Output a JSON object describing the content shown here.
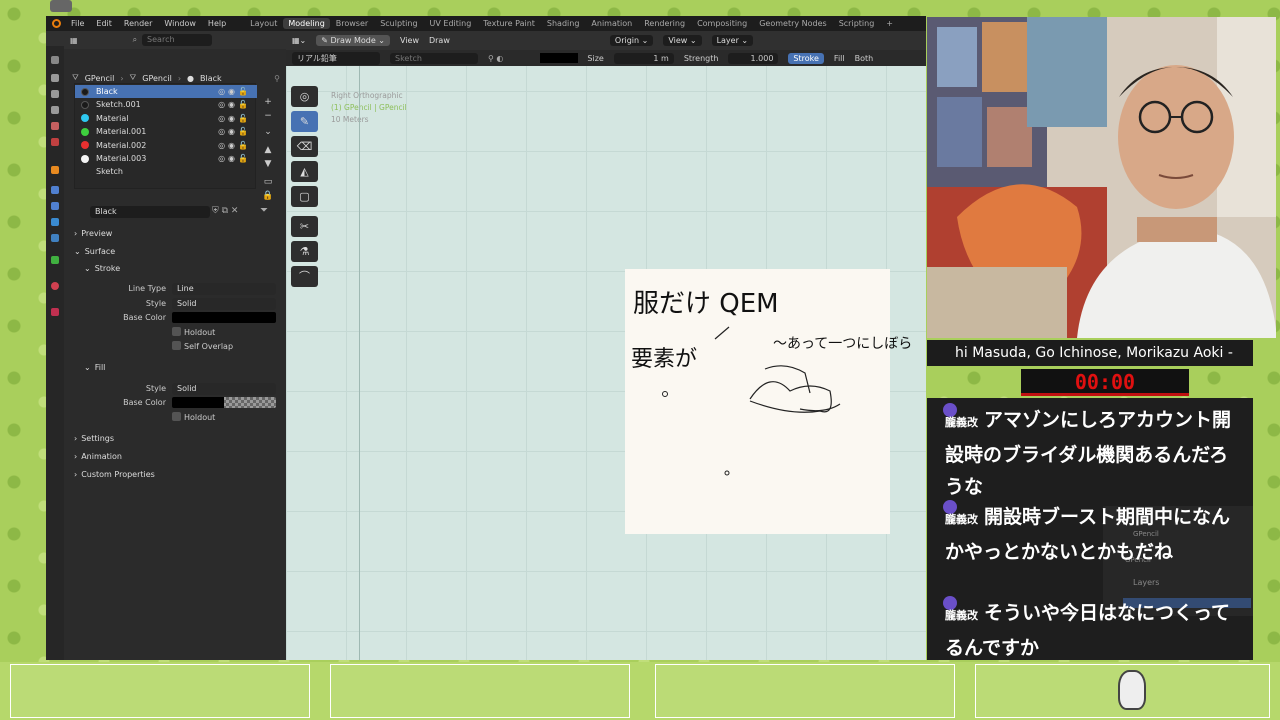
{
  "menu": {
    "items": [
      "File",
      "Edit",
      "Render",
      "Window",
      "Help"
    ]
  },
  "workspaces": [
    "Layout",
    "Modeling",
    "Browser",
    "Sculpting",
    "UV Editing",
    "Texture Paint",
    "Shading",
    "Animation",
    "Rendering",
    "Compositing",
    "Geometry Nodes",
    "Scripting",
    "+"
  ],
  "active_workspace": "Modeling",
  "properties": {
    "search_placeholder": "Search",
    "breadcrumb": [
      "GPencil",
      "GPencil",
      "Black"
    ],
    "materials": [
      {
        "name": "Black",
        "color": "#1a1a1a"
      },
      {
        "name": "Sketch.001",
        "color": "#1a1a1a"
      },
      {
        "name": "Material",
        "color": "#2ec8f0"
      },
      {
        "name": "Material.001",
        "color": "#3ed03e"
      },
      {
        "name": "Material.002",
        "color": "#e83030"
      },
      {
        "name": "Material.003",
        "color": "#f4f4f4"
      },
      {
        "name": "Sketch",
        "color": ""
      }
    ],
    "material_name": "Black",
    "preview": "Preview",
    "surface": "Surface",
    "stroke": "Stroke",
    "line_type_label": "Line Type",
    "line_type": "Line",
    "style_label": "Style",
    "style": "Solid",
    "base_color_label": "Base Color",
    "holdout": "Holdout",
    "self_overlap": "Self Overlap",
    "fill": "Fill",
    "fill_style": "Solid",
    "settings": "Settings",
    "animation": "Animation",
    "custom_properties": "Custom Properties"
  },
  "viewport": {
    "mode": "Draw Mode",
    "view": "View",
    "draw": "Draw",
    "origin": "Origin",
    "view2": "View",
    "layer": "Layer",
    "brush": "リアル鉛筆",
    "material": "Sketch",
    "size_label": "Size",
    "size": "1 m",
    "strength_label": "Strength",
    "strength": "1.000",
    "stroke": "Stroke",
    "fill": "Fill",
    "both": "Both",
    "overlay_view": "Right Orthographic",
    "overlay_object": "(1) GPencil | GPencil",
    "overlay_scale": "10 Meters"
  },
  "drawing": {
    "text1": "服だけ QEM",
    "text2": "要素が",
    "text3": "〜あって一つにしぼら"
  },
  "stream": {
    "names": "hi Masuda, Go Ichinose, Morikazu Aoki -",
    "timer": "00:00",
    "chat": [
      {
        "user": "朧義改",
        "text": "アマゾンにしろアカウント開設時のブライダル機関あるんだろうな"
      },
      {
        "user": "朧義改",
        "text": "開設時ブースト期間中になんかやっとかないとかもだね"
      },
      {
        "user": "朧義改",
        "text": "そういや今日はなにつくってるんですか"
      }
    ],
    "side_panel": {
      "gp": "GPencil",
      "gp2": "GPencil",
      "layers": "Layers"
    }
  },
  "colors": {
    "accent": "#4772b3",
    "blender_orange": "#e87d0d",
    "timer_red": "#e01010"
  }
}
